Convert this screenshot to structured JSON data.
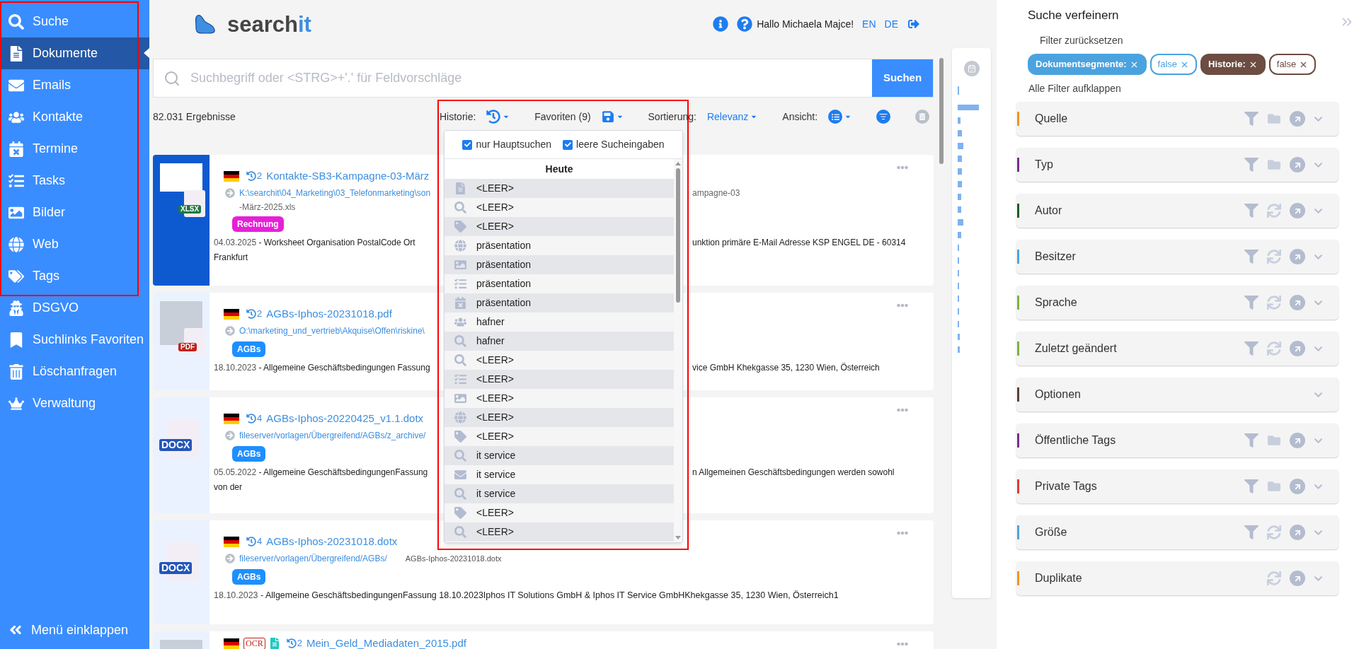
{
  "sidebar": {
    "items": [
      {
        "label": "Suche",
        "kind": "search",
        "selected": false
      },
      {
        "label": "Dokumente",
        "kind": "document",
        "selected": true
      },
      {
        "label": "Emails",
        "kind": "mail",
        "selected": false
      },
      {
        "label": "Kontakte",
        "kind": "users",
        "selected": false
      },
      {
        "label": "Termine",
        "kind": "calendar",
        "selected": false
      },
      {
        "label": "Tasks",
        "kind": "tasks",
        "selected": false
      },
      {
        "label": "Bilder",
        "kind": "image",
        "selected": false
      },
      {
        "label": "Web",
        "kind": "globe",
        "selected": false
      },
      {
        "label": "Tags",
        "kind": "tags",
        "selected": false
      },
      {
        "label": "DSGVO",
        "kind": "spy",
        "selected": false
      },
      {
        "label": "Suchlinks Favoriten",
        "kind": "bookmark",
        "selected": false
      },
      {
        "label": "Löschanfragen",
        "kind": "trash",
        "selected": false
      },
      {
        "label": "Verwaltung",
        "kind": "crown",
        "selected": false
      }
    ],
    "collapse": "Menü einklappen"
  },
  "header": {
    "logo": {
      "text": "search",
      "accent": "it"
    },
    "greeting": "Hallo Michaela Majce!",
    "languages": [
      "EN",
      "DE"
    ]
  },
  "search": {
    "placeholder": "Suchbegriff oder <STRG>+'.' für Feldvorschläge",
    "button": "Suchen"
  },
  "toolbar": {
    "count": "82.031 Ergebnisse",
    "history_label": "Historie:",
    "favorites_label": "Favoriten (9)",
    "sort_label": "Sortierung:",
    "sort_value": "Relevanz",
    "view_label": "Ansicht:"
  },
  "history_dropdown": {
    "options": [
      {
        "label": "nur Hauptsuchen",
        "checked": true
      },
      {
        "label": "leere Sucheingaben",
        "checked": true
      }
    ],
    "group": "Heute",
    "entries": [
      {
        "kind": "document",
        "text": "<LEER>"
      },
      {
        "kind": "search",
        "text": "<LEER>"
      },
      {
        "kind": "tag",
        "text": "<LEER>"
      },
      {
        "kind": "globe",
        "text": "präsentation"
      },
      {
        "kind": "image",
        "text": "präsentation"
      },
      {
        "kind": "tasks",
        "text": "präsentation"
      },
      {
        "kind": "calendar",
        "text": "präsentation"
      },
      {
        "kind": "users",
        "text": "hafner"
      },
      {
        "kind": "search",
        "text": "hafner"
      },
      {
        "kind": "search",
        "text": "<LEER>"
      },
      {
        "kind": "tasks",
        "text": "<LEER>"
      },
      {
        "kind": "image",
        "text": "<LEER>"
      },
      {
        "kind": "globe",
        "text": "<LEER>"
      },
      {
        "kind": "tag",
        "text": "<LEER>"
      },
      {
        "kind": "search",
        "text": "it service"
      },
      {
        "kind": "mail",
        "text": "it service"
      },
      {
        "kind": "search",
        "text": "it service"
      },
      {
        "kind": "tag",
        "text": "<LEER>"
      },
      {
        "kind": "search",
        "text": "<LEER>"
      }
    ]
  },
  "results": [
    {
      "selected": true,
      "kind": "sheet",
      "file_badge": "XLSX",
      "version": "2",
      "title": "Kontakte-SB3-Kampagne-03-März",
      "path": "K:\\searchit\\04_Marketing\\03_Telefonmarketing\\son",
      "path_end": "ampagne-03",
      "path_line2": "-März-2025.xls",
      "tag": {
        "label": "Rechnung",
        "color": "#e620d8"
      },
      "date": "04.03.2025",
      "text_start": "- Worksheet Organisation PostalCode Ort",
      "text_end": "unktion primäre E-Mail Adresse KSP ENGEL DE - 60314",
      "line2": "Frankfurt"
    },
    {
      "selected": false,
      "kind": "document",
      "file_badge": "PDF",
      "version": "2",
      "title": "AGBs-Iphos-20231018.pdf",
      "path": "O:\\marketing_und_vertrieb\\Akquise\\Offen\\riskine\\",
      "tag": {
        "label": "AGBs",
        "color": "#1e8fff"
      },
      "date": "18.10.2023",
      "text_start": "- Allgemeine Geschäftsbedingungen Fassung",
      "text_end": "vice GmbH Khekgasse 35, 1230 Wien, Österreich"
    },
    {
      "selected": false,
      "kind": "docx",
      "file_badge": "DOCX",
      "version": "4",
      "title": "AGBs-Iphos-20220425_v1.1.dotx",
      "path": "fileserver/vorlagen/Übergreifend/AGBs/z_archive/",
      "tag": {
        "label": "AGBs",
        "color": "#1e8fff"
      },
      "date": "05.05.2022",
      "text_start": "- Allgemeine GeschäftsbedingungenFassung",
      "text_end": "n Allgemeinen Geschäftsbedingungen werden sowohl",
      "line2": "von der"
    },
    {
      "selected": false,
      "kind": "docx",
      "file_badge": "DOCX",
      "version": "4",
      "title": "AGBs-Iphos-20231018.dotx",
      "path": "fileserver/vorlagen/Übergreifend/AGBs/",
      "file_name": "AGBs-Iphos-20231018.dotx",
      "tag": {
        "label": "AGBs",
        "color": "#1e8fff"
      },
      "date": "18.10.2023",
      "text_start": "- Allgemeine GeschäftsbedingungenFassung 18.10.2023Iphos IT Solutions GmbH & Iphos IT Service GmbHKhekgasse 35, 1230 Wien, Österreich1"
    },
    {
      "selected": false,
      "kind": "document",
      "ocr": "OCR",
      "version": "2",
      "title": "Mein_Geld_Mediadaten_2015.pdf"
    }
  ],
  "refine": {
    "title": "Suche verfeinern",
    "reset": "Filter zurücksetzen",
    "chips": [
      {
        "kind": "label",
        "text": "Dokumentsegmente:",
        "color": "#4aa3df"
      },
      {
        "kind": "value",
        "text": "false",
        "color": "#4aa3df"
      },
      {
        "kind": "label",
        "text": "Historie:",
        "color": "#6d4c41"
      },
      {
        "kind": "value",
        "text": "false",
        "color": "#6d4c41"
      }
    ],
    "expand_all": "Alle Filter aufklappen",
    "sections": [
      {
        "label": "Quelle",
        "color": "#f7931e",
        "actions": [
          {
            "kind": "filter"
          },
          {
            "kind": "folder"
          },
          {
            "kind": "open"
          }
        ]
      },
      {
        "label": "Typ",
        "color": "#7b2d8e",
        "actions": [
          {
            "kind": "filter"
          },
          {
            "kind": "folder"
          },
          {
            "kind": "open"
          }
        ]
      },
      {
        "label": "Autor",
        "color": "#1b5e20",
        "actions": [
          {
            "kind": "filter"
          },
          {
            "kind": "sync"
          },
          {
            "kind": "open"
          }
        ]
      },
      {
        "label": "Besitzer",
        "color": "#4fa3e0",
        "actions": [
          {
            "kind": "filter"
          },
          {
            "kind": "sync"
          },
          {
            "kind": "open"
          }
        ]
      },
      {
        "label": "Sprache",
        "color": "#7cb342",
        "actions": [
          {
            "kind": "filter"
          },
          {
            "kind": "sync"
          },
          {
            "kind": "open"
          }
        ]
      },
      {
        "label": "Zuletzt geändert",
        "color": "#7cb342",
        "actions": [
          {
            "kind": "filter"
          },
          {
            "kind": "sync"
          },
          {
            "kind": "open"
          }
        ]
      },
      {
        "label": "Optionen",
        "color": "#5d4037"
      },
      {
        "label": "Öffentliche Tags",
        "color": "#7b2d8e",
        "actions": [
          {
            "kind": "filter"
          },
          {
            "kind": "folder"
          },
          {
            "kind": "open"
          }
        ]
      },
      {
        "label": "Private Tags",
        "color": "#e53935",
        "actions": [
          {
            "kind": "filter"
          },
          {
            "kind": "folder"
          },
          {
            "kind": "open"
          }
        ]
      },
      {
        "label": "Größe",
        "color": "#4fa3e0",
        "actions": [
          {
            "kind": "filter"
          },
          {
            "kind": "sync"
          },
          {
            "kind": "open"
          }
        ]
      },
      {
        "label": "Duplikate",
        "color": "#f7931e",
        "actions": [
          {
            "kind": "sync"
          },
          {
            "kind": "open"
          }
        ]
      }
    ]
  }
}
